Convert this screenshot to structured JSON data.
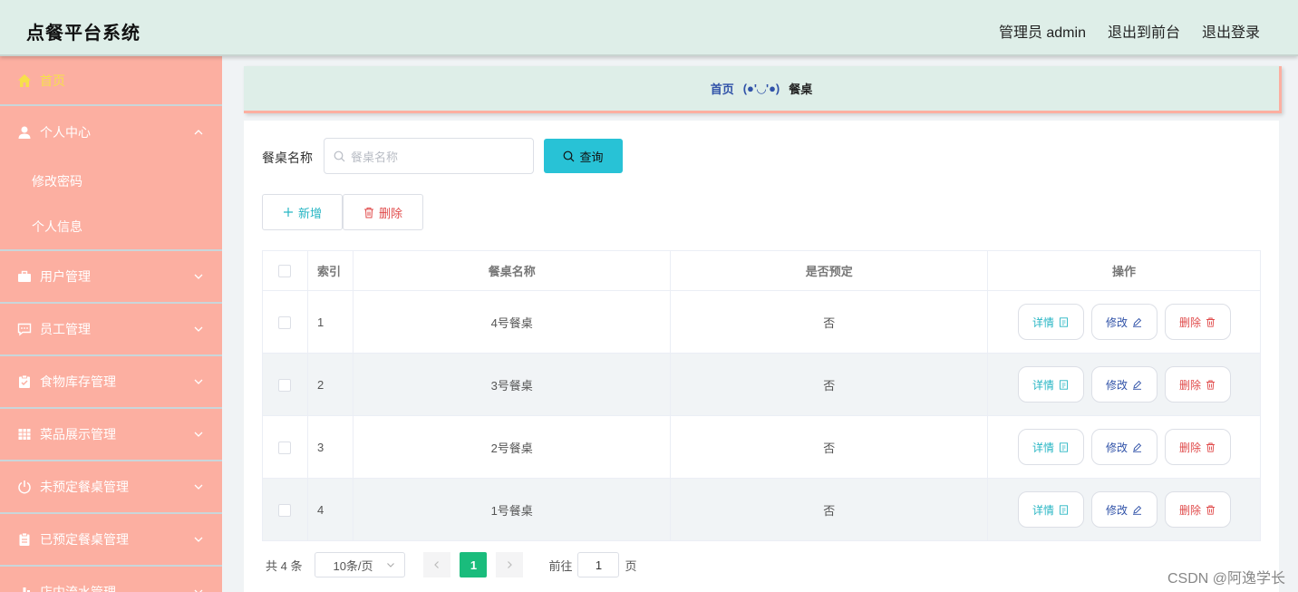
{
  "header": {
    "app_title": "点餐平台系统",
    "admin_label": "管理员 admin",
    "front_link": "退出到前台",
    "logout_link": "退出登录"
  },
  "sidebar": {
    "items": [
      {
        "label": "首页",
        "icon": "home-icon"
      },
      {
        "label": "个人中心",
        "icon": "user-icon",
        "expanded": true
      },
      {
        "label": "修改密码"
      },
      {
        "label": "个人信息"
      },
      {
        "label": "用户管理",
        "icon": "briefcase-icon"
      },
      {
        "label": "员工管理",
        "icon": "chat-icon"
      },
      {
        "label": "食物库存管理",
        "icon": "clipboard-check-icon"
      },
      {
        "label": "菜品展示管理",
        "icon": "grid-icon"
      },
      {
        "label": "未预定餐桌管理",
        "icon": "power-icon"
      },
      {
        "label": "已预定餐桌管理",
        "icon": "clipboard-icon"
      },
      {
        "label": "店内流水管理",
        "icon": "chart-icon"
      }
    ]
  },
  "breadcrumb": {
    "home": "首页",
    "separator": "(●'◡'●)",
    "current": "餐桌"
  },
  "search": {
    "label": "餐桌名称",
    "placeholder": "餐桌名称",
    "button": "查询"
  },
  "actions": {
    "add": "新增",
    "delete": "删除"
  },
  "table": {
    "headers": [
      "索引",
      "餐桌名称",
      "是否预定",
      "操作"
    ],
    "rows": [
      {
        "index": "1",
        "name": "4号餐桌",
        "reserved": "否"
      },
      {
        "index": "2",
        "name": "3号餐桌",
        "reserved": "否"
      },
      {
        "index": "3",
        "name": "2号餐桌",
        "reserved": "否"
      },
      {
        "index": "4",
        "name": "1号餐桌",
        "reserved": "否"
      }
    ],
    "op_labels": {
      "detail": "详情",
      "edit": "修改",
      "remove": "删除"
    }
  },
  "pagination": {
    "total": "共 4 条",
    "page_size": "10条/页",
    "current_page": "1",
    "goto_label": "前往",
    "goto_value": "1",
    "page_suffix": "页"
  },
  "watermark": "CSDN @阿逸学长",
  "colors": {
    "header_bg": "#deeee8",
    "sidebar_bg": "#fcafa1",
    "accent_cyan": "#28c2d6",
    "page_active": "#1abc7c",
    "danger": "#e04b4b"
  }
}
